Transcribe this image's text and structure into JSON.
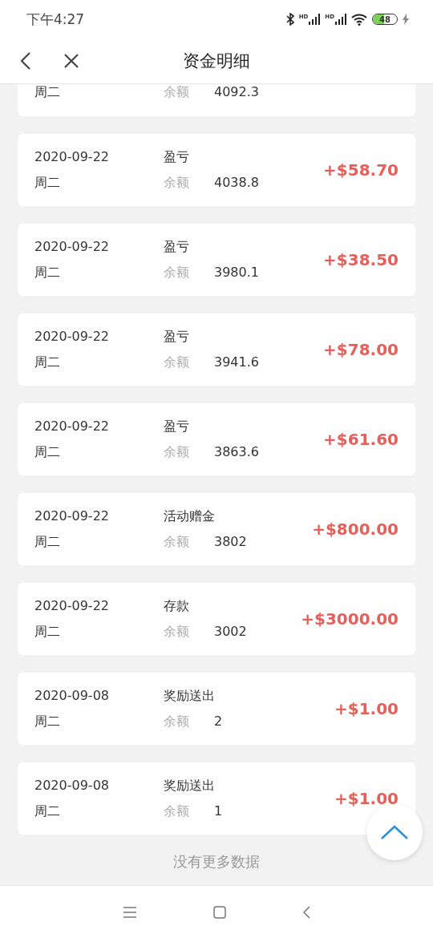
{
  "status_bar": {
    "time": "下午4:27",
    "signal_labels": [
      "HD",
      "HD"
    ],
    "battery": "48"
  },
  "header": {
    "title": "资金明细"
  },
  "records": [
    {
      "kind": "partial",
      "weekday": "周二",
      "balance_label": "余额",
      "balance": "4092.3"
    },
    {
      "kind": "full",
      "date": "2020-09-22",
      "weekday": "周二",
      "type": "盈亏",
      "balance_label": "余额",
      "balance": "4038.8",
      "amount": "+$58.70"
    },
    {
      "kind": "full",
      "date": "2020-09-22",
      "weekday": "周二",
      "type": "盈亏",
      "balance_label": "余额",
      "balance": "3980.1",
      "amount": "+$38.50"
    },
    {
      "kind": "full",
      "date": "2020-09-22",
      "weekday": "周二",
      "type": "盈亏",
      "balance_label": "余额",
      "balance": "3941.6",
      "amount": "+$78.00"
    },
    {
      "kind": "full",
      "date": "2020-09-22",
      "weekday": "周二",
      "type": "盈亏",
      "balance_label": "余额",
      "balance": "3863.6",
      "amount": "+$61.60"
    },
    {
      "kind": "full",
      "date": "2020-09-22",
      "weekday": "周二",
      "type": "活动赠金",
      "balance_label": "余额",
      "balance": "3802",
      "amount": "+$800.00"
    },
    {
      "kind": "full",
      "date": "2020-09-22",
      "weekday": "周二",
      "type": "存款",
      "balance_label": "余额",
      "balance": "3002",
      "amount": "+$3000.00"
    },
    {
      "kind": "full",
      "date": "2020-09-08",
      "weekday": "周二",
      "type": "奖励送出",
      "balance_label": "余额",
      "balance": "2",
      "amount": "+$1.00"
    },
    {
      "kind": "full",
      "date": "2020-09-08",
      "weekday": "周二",
      "type": "奖励送出",
      "balance_label": "余额",
      "balance": "1",
      "amount": "+$1.00"
    }
  ],
  "footer_text": "没有更多数据"
}
